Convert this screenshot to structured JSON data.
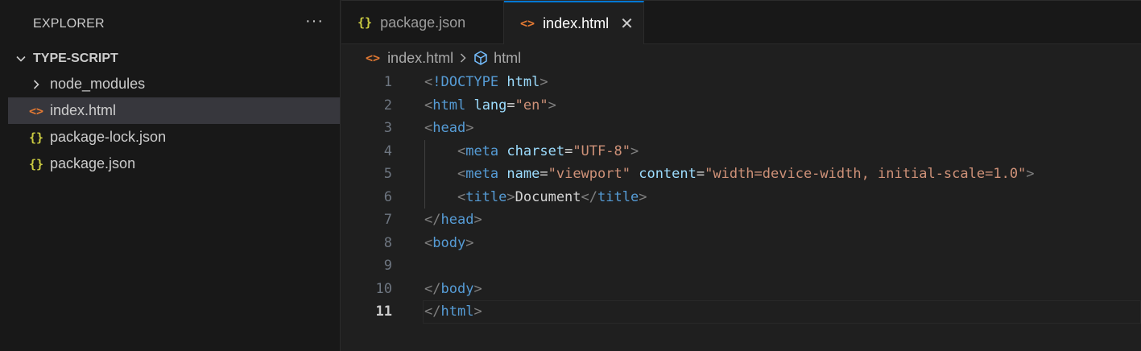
{
  "sidebar": {
    "title": "EXPLORER",
    "more_label": "···",
    "folder": "TYPE-SCRIPT",
    "items": [
      {
        "label": "node_modules",
        "icon": "chevron-right-icon",
        "type": "folder"
      },
      {
        "label": "index.html",
        "icon": "html-file-icon",
        "icon_glyph": "<>",
        "type": "html"
      },
      {
        "label": "package-lock.json",
        "icon": "json-file-icon",
        "icon_glyph": "{}",
        "type": "json"
      },
      {
        "label": "package.json",
        "icon": "json-file-icon",
        "icon_glyph": "{}",
        "type": "json"
      }
    ]
  },
  "tabs": [
    {
      "label": "package.json",
      "icon_glyph": "{}",
      "active": false
    },
    {
      "label": "index.html",
      "icon_glyph": "<>",
      "active": true,
      "close": "✕"
    }
  ],
  "breadcrumb": {
    "file": "index.html",
    "file_icon": "<>",
    "symbol": "html"
  },
  "editor": {
    "current_line": 11,
    "lines": [
      {
        "n": "1"
      },
      {
        "n": "2"
      },
      {
        "n": "3"
      },
      {
        "n": "4"
      },
      {
        "n": "5"
      },
      {
        "n": "6"
      },
      {
        "n": "7"
      },
      {
        "n": "8"
      },
      {
        "n": "9"
      },
      {
        "n": "10"
      },
      {
        "n": "11"
      }
    ],
    "tokens": {
      "l1_doctype": "!DOCTYPE",
      "l1_html": "html",
      "l2_tag": "html",
      "l2_attr": "lang",
      "l2_val": "\"en\"",
      "l3_tag": "head",
      "l4_tag": "meta",
      "l4_attr": "charset",
      "l4_val": "\"UTF-8\"",
      "l5_tag": "meta",
      "l5_attr1": "name",
      "l5_val1": "\"viewport\"",
      "l5_attr2": "content",
      "l5_val2": "\"width=device-width, initial-scale=1.0\"",
      "l6_tag": "title",
      "l6_text": "Document",
      "l6_close": "title",
      "l7_tag": "head",
      "l8_tag": "body",
      "l10_tag": "body",
      "l11_tag": "html"
    }
  },
  "colors": {
    "html_icon": "#e37933",
    "json_icon": "#cbcb41",
    "tag": "#569cd6",
    "attr": "#9cdcfe",
    "string": "#ce9178",
    "active_tab_border": "#0078d4"
  }
}
